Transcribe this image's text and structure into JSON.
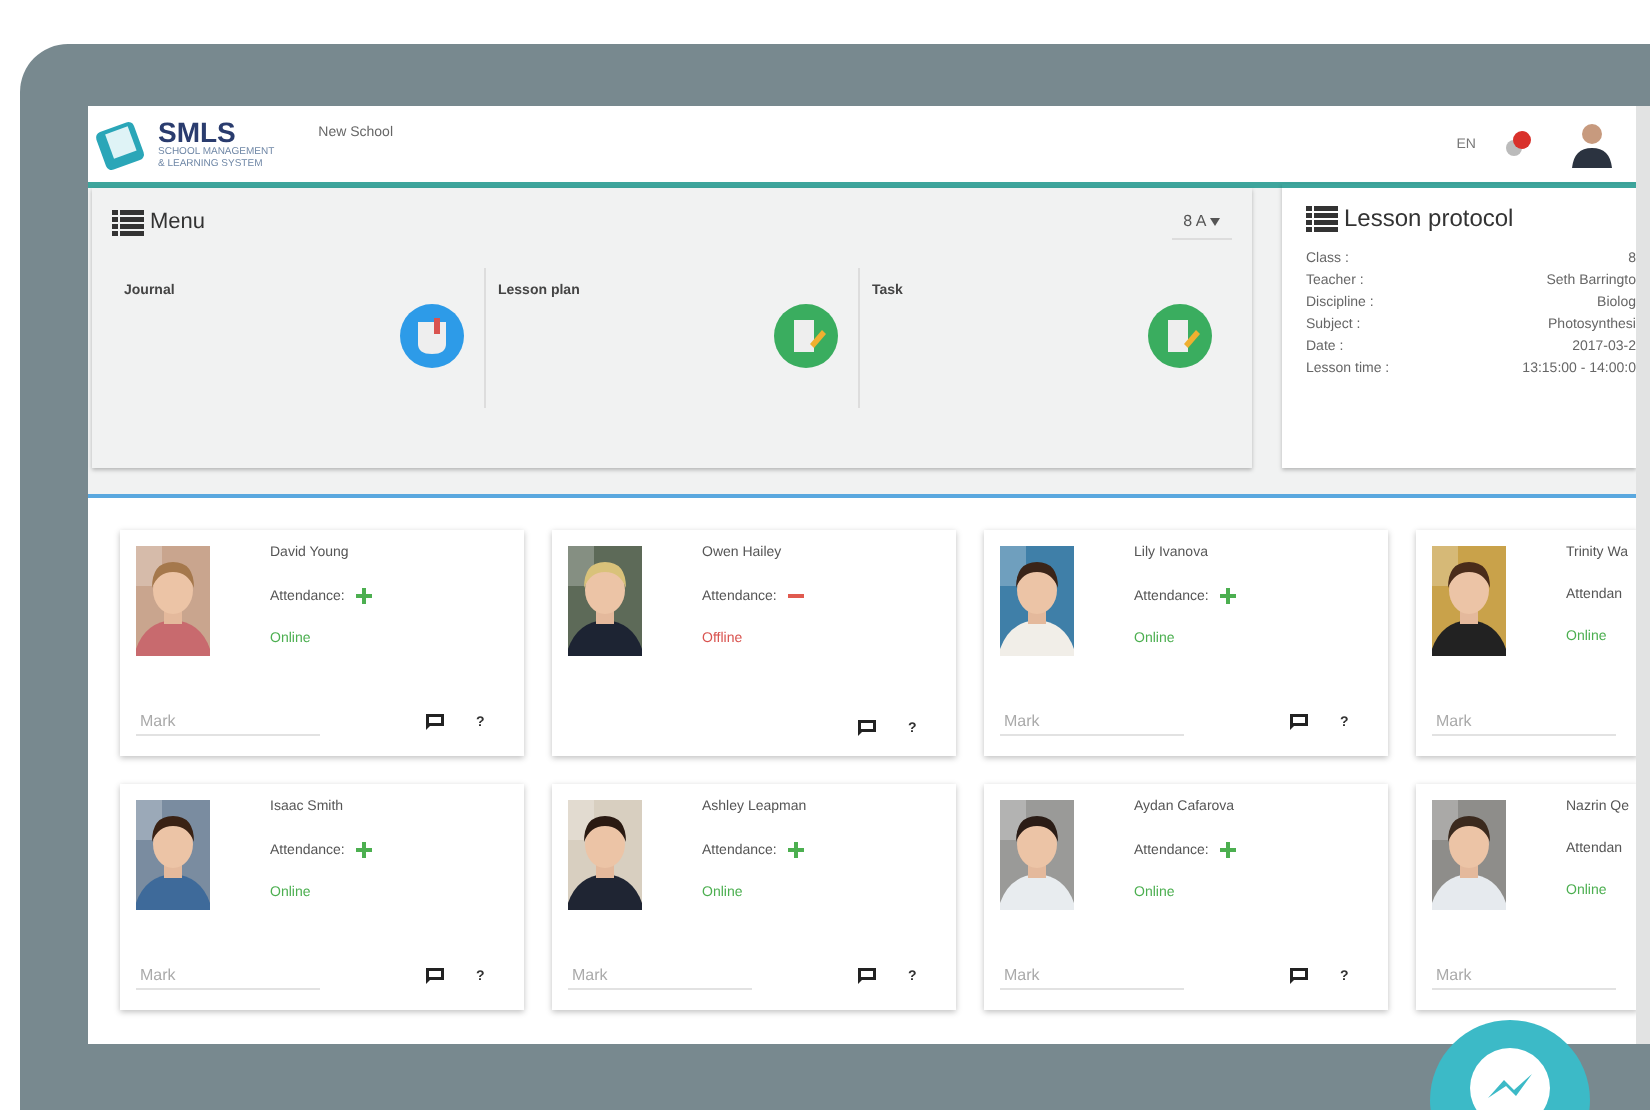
{
  "header": {
    "logo_title": "SMLS",
    "logo_subtitle": [
      "SCHOOL MANAGEMENT",
      "& LEARNING SYSTEM"
    ],
    "school": "New School",
    "language": "EN"
  },
  "menu": {
    "title": "Menu",
    "class_select": "8 A",
    "items": [
      {
        "label": "Journal",
        "kind": "journal",
        "color": "#2d9be8"
      },
      {
        "label": "Lesson plan",
        "kind": "plan",
        "color": "#3aad5f"
      },
      {
        "label": "Task",
        "kind": "plan",
        "color": "#3aad5f"
      }
    ]
  },
  "lesson_protocol": {
    "title": "Lesson protocol",
    "rows": [
      {
        "label": "Class :",
        "value": "8"
      },
      {
        "label": "Teacher :",
        "value": "Seth Barringto"
      },
      {
        "label": "Discipline :",
        "value": "Biolog"
      },
      {
        "label": "Subject :",
        "value": "Photosynthesi"
      },
      {
        "label": "Date :",
        "value": "2017-03-2"
      },
      {
        "label": "Lesson time :",
        "value": "13:15:00 - 14:00:0"
      }
    ]
  },
  "students": [
    {
      "name": "David Young",
      "attendance": "Attendance:",
      "present": true,
      "status": "Online",
      "online": true,
      "mark_placeholder": "Mark",
      "help": "?"
    },
    {
      "name": "Owen Hailey",
      "attendance": "Attendance:",
      "present": false,
      "status": "Offline",
      "online": false,
      "help": "?"
    },
    {
      "name": "Lily Ivanova",
      "attendance": "Attendance:",
      "present": true,
      "status": "Online",
      "online": true,
      "mark_placeholder": "Mark",
      "help": "?"
    },
    {
      "name": "Trinity Wa",
      "attendance": "Attendan",
      "status": "Online",
      "online": true,
      "mark_placeholder": "Mark"
    },
    {
      "name": "Isaac Smith",
      "attendance": "Attendance:",
      "present": true,
      "status": "Online",
      "online": true,
      "mark_placeholder": "Mark",
      "help": "?"
    },
    {
      "name": "Ashley Leapman",
      "attendance": "Attendance:",
      "present": true,
      "status": "Online",
      "online": true,
      "mark_placeholder": "Mark",
      "help": "?"
    },
    {
      "name": "Aydan Cafarova",
      "attendance": "Attendance:",
      "present": true,
      "status": "Online",
      "online": true,
      "mark_placeholder": "Mark",
      "help": "?"
    },
    {
      "name": "Nazrin Qe",
      "attendance": "Attendan",
      "status": "Online",
      "online": true,
      "mark_placeholder": "Mark"
    }
  ]
}
